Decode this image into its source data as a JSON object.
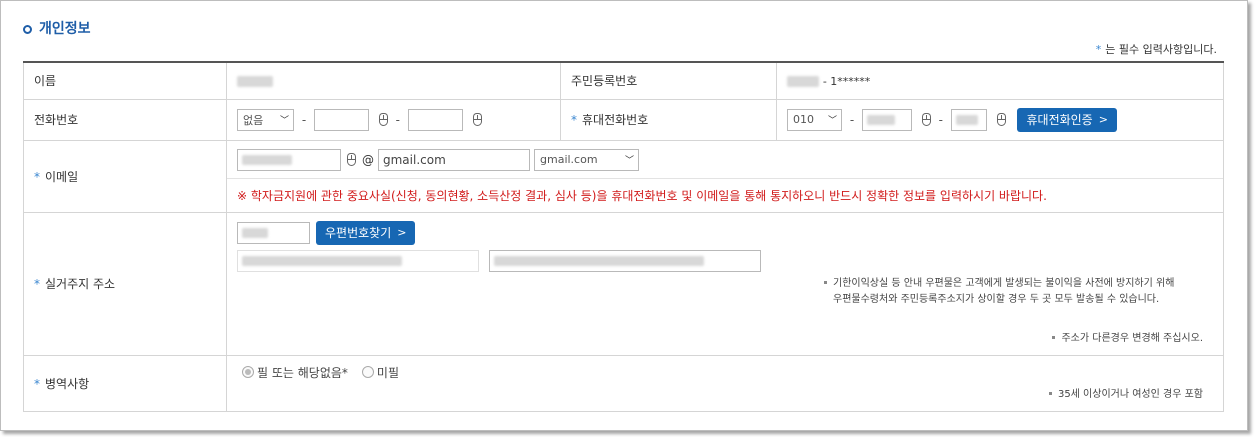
{
  "section": {
    "title": "개인정보"
  },
  "required_note": {
    "star": "*",
    "text": "는 필수 입력사항입니다."
  },
  "rows": {
    "name": {
      "label": "이름"
    },
    "rrn": {
      "label": "주민등록번호",
      "suffix": "- 1******"
    },
    "phone": {
      "label": "전화번호",
      "area_select": "없음"
    },
    "mobile": {
      "label": "휴대전화번호",
      "prefix_select": "010",
      "verify_button": "휴대전화인증"
    },
    "email": {
      "label": "이메일",
      "at": "@",
      "domain_value": "gmail.com",
      "domain_select": "gmail.com",
      "warning": "※ 학자금지원에 관한 중요사실(신청, 동의현황, 소득산정 결과, 심사 등)을 휴대전화번호 및 이메일을 통해 통지하오니 반드시 정확한 정보를 입력하시기 바랍니다."
    },
    "address": {
      "label": "실거주지 주소",
      "zip_button": "우편번호찾기",
      "note_line1": "기한이익상실 등 안내 우편물은 고객에게 발생되는 불이익을 사전에 방지하기 위해",
      "note_line2": "우편물수령처와 주민등록주소지가 상이할 경우 두 곳 모두 발송될 수 있습니다.",
      "note_change": "주소가 다른경우 변경해 주십시오."
    },
    "military": {
      "label": "병역사항",
      "option1": "필 또는 해당없음*",
      "option2": "미필",
      "note": "35세 이상이거나 여성인 경우 포함"
    }
  },
  "colors": {
    "accent": "#1f5ea8",
    "button": "#1767b3",
    "warning": "#d11a1a",
    "required": "#3a86d0"
  }
}
